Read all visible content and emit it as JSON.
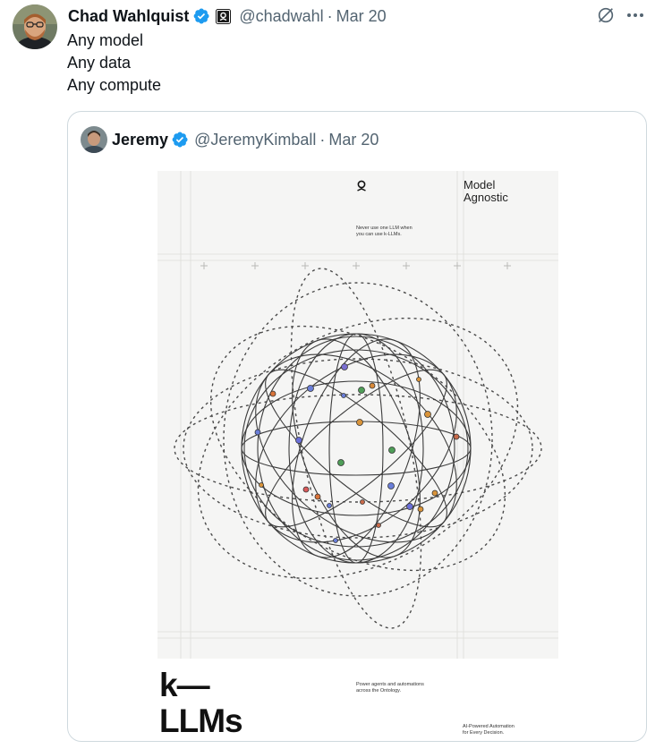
{
  "tweet": {
    "author_name": "Chad Wahlquist",
    "author_handle": "@chadwahl",
    "separator": "·",
    "date": "Mar 20",
    "lines": [
      "Any model",
      "Any data",
      "Any compute"
    ]
  },
  "icons": {
    "verified": "verified-badge-icon",
    "affiliation": "affiliation-badge-icon",
    "grok": "grok-icon",
    "more": "more-icon"
  },
  "colors": {
    "verified_blue": "#1d9bf0",
    "secondary_text": "#536471",
    "border": "#cfd9de"
  },
  "quote": {
    "author_name": "Jeremy",
    "author_handle": "@JeremyKimball",
    "separator": "·",
    "date": "Mar 20",
    "image": {
      "title_lines": [
        "Model",
        "Agnostic"
      ],
      "tagline_lines": [
        "Never use one LLM when",
        "you can use k-LLMs."
      ],
      "brand_lines": [
        "k—",
        "LLMs"
      ],
      "subtitle_lines": [
        "Power agents and automations",
        "across the Ontology."
      ],
      "footer_lines": [
        "AI-Powered Automation",
        "for Every Decision."
      ]
    }
  }
}
